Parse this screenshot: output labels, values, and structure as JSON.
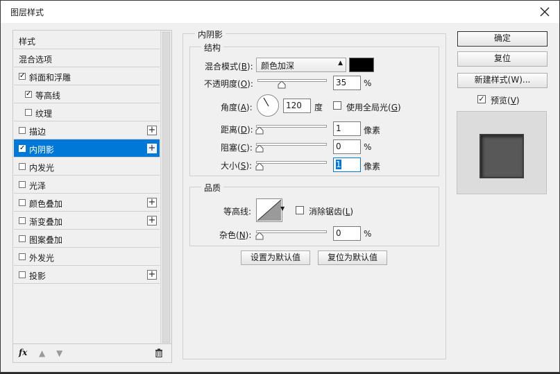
{
  "window": {
    "title": "图层样式",
    "close_icon": "close-icon"
  },
  "stylelist": {
    "items": [
      {
        "label": "样式",
        "checkbox": false,
        "checked": false,
        "indent": 0,
        "plus": false,
        "selected": false
      },
      {
        "label": "混合选项",
        "checkbox": false,
        "checked": false,
        "indent": 0,
        "plus": false,
        "selected": false
      },
      {
        "label": "斜面和浮雕",
        "checkbox": true,
        "checked": true,
        "indent": 0,
        "plus": false,
        "selected": false
      },
      {
        "label": "等高线",
        "checkbox": true,
        "checked": true,
        "indent": 1,
        "plus": false,
        "selected": false
      },
      {
        "label": "纹理",
        "checkbox": true,
        "checked": false,
        "indent": 1,
        "plus": false,
        "selected": false
      },
      {
        "label": "描边",
        "checkbox": true,
        "checked": false,
        "indent": 0,
        "plus": true,
        "selected": false
      },
      {
        "label": "内阴影",
        "checkbox": true,
        "checked": true,
        "indent": 0,
        "plus": true,
        "selected": true
      },
      {
        "label": "内发光",
        "checkbox": true,
        "checked": false,
        "indent": 0,
        "plus": false,
        "selected": false
      },
      {
        "label": "光泽",
        "checkbox": true,
        "checked": false,
        "indent": 0,
        "plus": false,
        "selected": false
      },
      {
        "label": "颜色叠加",
        "checkbox": true,
        "checked": false,
        "indent": 0,
        "plus": true,
        "selected": false
      },
      {
        "label": "渐变叠加",
        "checkbox": true,
        "checked": false,
        "indent": 0,
        "plus": true,
        "selected": false
      },
      {
        "label": "图案叠加",
        "checkbox": true,
        "checked": false,
        "indent": 0,
        "plus": false,
        "selected": false
      },
      {
        "label": "外发光",
        "checkbox": true,
        "checked": false,
        "indent": 0,
        "plus": false,
        "selected": false
      },
      {
        "label": "投影",
        "checkbox": true,
        "checked": false,
        "indent": 0,
        "plus": true,
        "selected": false
      }
    ],
    "footer": {
      "fx_label": "fx",
      "up_icon": "arrow-up-icon",
      "down_icon": "arrow-down-icon",
      "trash_icon": "trash-icon"
    }
  },
  "panel": {
    "title": "内阴影",
    "structure": {
      "legend": "结构",
      "blend_mode_label": "混合模式(",
      "blend_mode_key": "B",
      "blend_mode_tail": "):",
      "blend_mode_value": "颜色加深",
      "color": "#000000",
      "opacity_label": "不透明度(",
      "opacity_key": "O",
      "opacity_tail": "):",
      "opacity_value": "35",
      "opacity_pct": 35,
      "opacity_unit": "%",
      "angle_label": "角度(",
      "angle_key": "A",
      "angle_tail": "):",
      "angle_value": "120",
      "angle_unit": "度",
      "global_light_label": "使用全局光(",
      "global_light_key": "G",
      "global_light_tail": ")",
      "global_light_checked": false,
      "distance_label": "距离(",
      "distance_key": "D",
      "distance_tail": "):",
      "distance_value": "1",
      "distance_unit": "像素",
      "choke_label": "阻塞(",
      "choke_key": "C",
      "choke_tail": "):",
      "choke_value": "0",
      "choke_unit": "%",
      "size_label": "大小(",
      "size_key": "S",
      "size_tail": "):",
      "size_value": "1",
      "size_unit": "像素"
    },
    "quality": {
      "legend": "品质",
      "contour_label": "等高线:",
      "antialias_label": "消除锯齿(",
      "antialias_key": "L",
      "antialias_tail": ")",
      "antialias_checked": false,
      "noise_label": "杂色(",
      "noise_key": "N",
      "noise_tail": "):",
      "noise_value": "0",
      "noise_unit": "%"
    },
    "set_default_button": "设置为默认值",
    "reset_default_button": "复位为默认值"
  },
  "actions": {
    "ok_button": "确定",
    "reset_button": "复位",
    "new_style_button": "新建样式(W)...",
    "preview_label": "预览(",
    "preview_key": "V",
    "preview_tail": ")",
    "preview_checked": true
  }
}
